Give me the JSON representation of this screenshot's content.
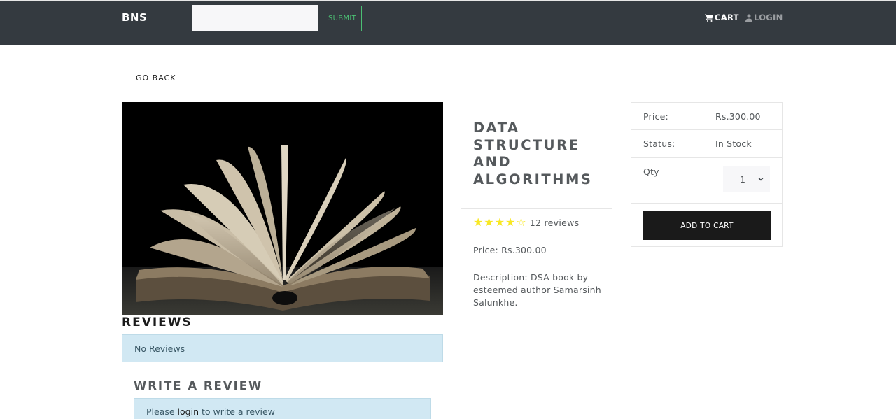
{
  "navbar": {
    "brand": "BNS",
    "search": {
      "value": "",
      "placeholder": ""
    },
    "submit_label": "SUBMIT",
    "cart_label": "CART",
    "login_label": "LOGIN",
    "cart_icon": "shopping-cart-icon",
    "login_icon": "user-icon"
  },
  "go_back_label": "GO BACK",
  "product": {
    "image_alt": "open-book-photo",
    "title": "DATA STRUCTURE AND ALGORITHMS",
    "rating": 3.5,
    "rating_max": 5,
    "reviews_text": "12 reviews",
    "price_line": "Price: Rs.300.00",
    "description": "Description: DSA book by esteemed author Samarsinh Salunkhe."
  },
  "cart_card": {
    "price_label": "Price:",
    "price_value": "Rs.300.00",
    "status_label": "Status:",
    "status_value": "In Stock",
    "qty_label": "Qty",
    "qty_value": "1",
    "add_to_cart_label": "ADD TO CART"
  },
  "reviews": {
    "title": "REVIEWS",
    "empty_text": "No Reviews",
    "write_title": "WRITE A REVIEW",
    "login_prompt_before": "Please ",
    "login_link": "login",
    "login_prompt_after": " to write a review"
  },
  "colors": {
    "navbar_bg": "#343a40",
    "accent_green": "#4bbf73",
    "star_yellow": "#f8e825",
    "alert_bg": "#d1e8f3",
    "button_dark": "#1a1a1a"
  }
}
